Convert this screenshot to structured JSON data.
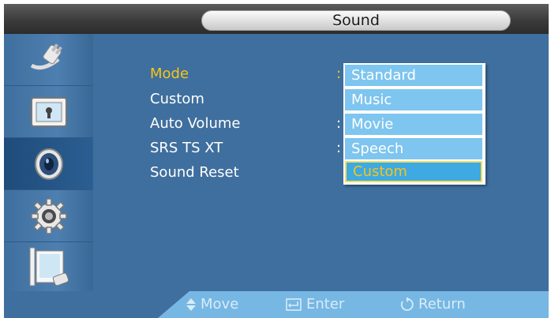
{
  "title": "Sound",
  "rail": {
    "items": [
      {
        "icon": "input-plug-icon"
      },
      {
        "icon": "picture-icon"
      },
      {
        "icon": "speaker-icon",
        "active": true
      },
      {
        "icon": "setup-gear-icon"
      },
      {
        "icon": "multi-screen-icon"
      }
    ]
  },
  "menu": {
    "items": [
      {
        "label": "Mode",
        "colon": ":",
        "selected": true
      },
      {
        "label": "Custom",
        "colon": ""
      },
      {
        "label": "Auto Volume",
        "colon": ":"
      },
      {
        "label": "SRS TS XT",
        "colon": ":"
      },
      {
        "label": "Sound Reset",
        "colon": ""
      }
    ]
  },
  "dropdown": {
    "options": [
      "Standard",
      "Music",
      "Movie",
      "Speech",
      "Custom"
    ],
    "highlighted_index": 4
  },
  "hints": {
    "move": "Move",
    "enter": "Enter",
    "return": "Return"
  },
  "colors": {
    "highlight": "#f5c518",
    "panel": "#3f6f9e",
    "option": "#7ec5ef"
  }
}
